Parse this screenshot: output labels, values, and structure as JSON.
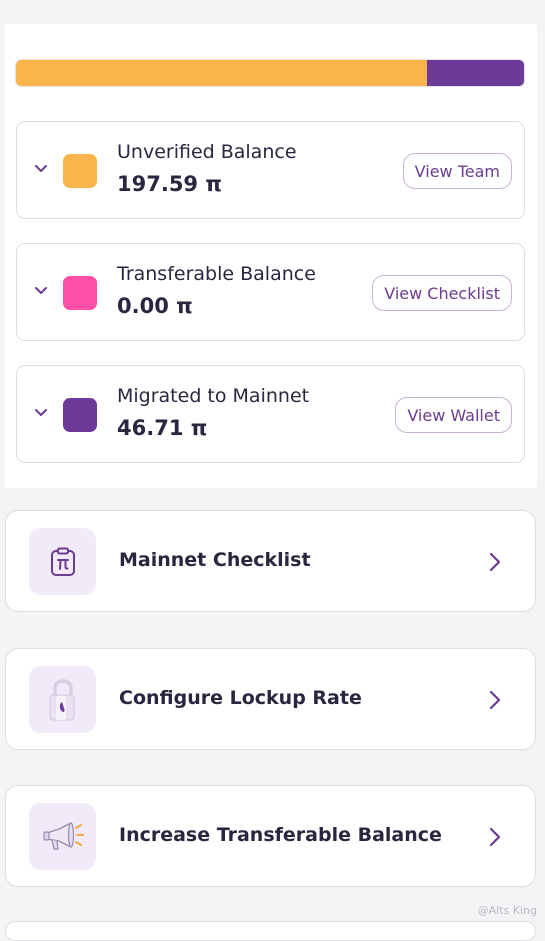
{
  "balance_bar": {
    "segments": [
      {
        "name": "unverified",
        "fraction": 0.8088,
        "color": "#f9b44b"
      },
      {
        "name": "transferable",
        "fraction": 0.0,
        "color": "#ff4fa7"
      },
      {
        "name": "migrated",
        "fraction": 0.1912,
        "color": "#6e3a97"
      }
    ]
  },
  "balances": [
    {
      "title": "Unverified Balance",
      "value": "197.59 π",
      "button": "View Team",
      "color": "#f9b44b"
    },
    {
      "title": "Transferable Balance",
      "value": "0.00 π",
      "button": "View Checklist",
      "color": "#ff4fa7"
    },
    {
      "title": "Migrated to Mainnet",
      "value": "46.71 π",
      "button": "View Wallet",
      "color": "#6e3a97"
    }
  ],
  "menu": [
    {
      "label": "Mainnet Checklist",
      "icon": "clipboard-pi-icon"
    },
    {
      "label": "Configure Lockup Rate",
      "icon": "padlock-icon"
    },
    {
      "label": "Increase Transferable Balance",
      "icon": "megaphone-icon"
    }
  ],
  "colors": {
    "accent": "#6b3c8f",
    "border": "#dedde3"
  },
  "watermark": "@Alts King"
}
